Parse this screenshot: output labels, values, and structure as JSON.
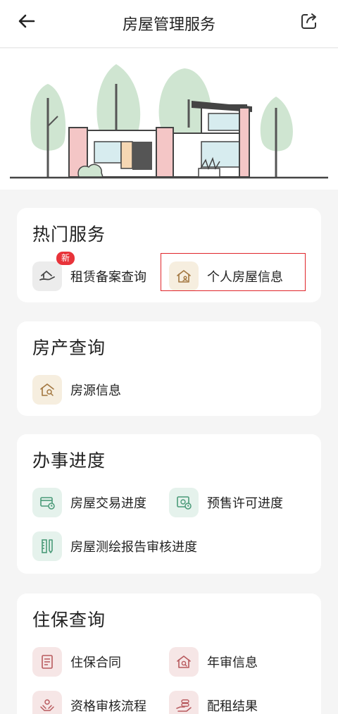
{
  "header": {
    "title": "房屋管理服务",
    "back_icon": "back-arrow-icon",
    "share_icon": "share-icon"
  },
  "hot": {
    "title": "热门服务",
    "items": [
      {
        "label": "租赁备案查询",
        "badge": "新",
        "icon": "house-hand-icon"
      },
      {
        "label": "个人房屋信息",
        "icon": "house-person-icon"
      }
    ]
  },
  "property": {
    "title": "房产查询",
    "items": [
      {
        "label": "房源信息",
        "icon": "house-search-icon"
      }
    ]
  },
  "progress": {
    "title": "办事进度",
    "items": [
      {
        "label": "房屋交易进度",
        "icon": "card-clock-icon"
      },
      {
        "label": "预售许可进度",
        "icon": "money-clock-icon"
      },
      {
        "label": "房屋测绘报告审核进度",
        "icon": "ruler-icon"
      }
    ]
  },
  "housing": {
    "title": "住保查询",
    "items": [
      {
        "label": "住保合同",
        "icon": "contract-icon"
      },
      {
        "label": "年审信息",
        "icon": "house-magnifier-icon"
      },
      {
        "label": "资格审核流程",
        "icon": "hands-icon"
      },
      {
        "label": "配租结果",
        "icon": "hand-coins-icon"
      }
    ]
  },
  "colors": {
    "badge": "#e8333a",
    "highlight_border": "#e0252b",
    "icon_green": "#4a9a78",
    "icon_tan": "#a2763f",
    "icon_pink": "#b85a5e"
  }
}
